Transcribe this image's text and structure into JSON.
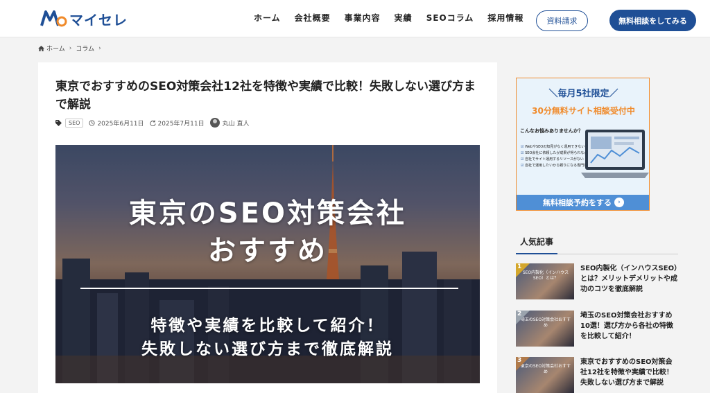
{
  "brand": {
    "name": "マイセレ",
    "color": "#1f4f96",
    "accent": "#f08a2a"
  },
  "nav": [
    "ホーム",
    "会社概要",
    "事業内容",
    "実績",
    "SEOコラム",
    "採用情報"
  ],
  "header_buttons": {
    "doc": "資料請求",
    "free": "無料相談をしてみる"
  },
  "breadcrumb": [
    "ホーム",
    "コラム"
  ],
  "post": {
    "title": "東京でおすすめのSEO対策会社12社を特徴や実績で比較！失敗しない選び方まで解説",
    "category": "SEO",
    "published": "2025年6月11日",
    "updated": "2025年7月11日",
    "author": "丸山 直人"
  },
  "hero": {
    "title_line1": "東京のSEO対策会社",
    "title_line2": "おすすめ",
    "sub_line1": "特徴や実績を比較して紹介！",
    "sub_line2": "失敗しない選び方まで徹底解説"
  },
  "ad": {
    "top": "＼毎月5社限定／",
    "sub": "30分無料サイト相談受付中",
    "question": "こんなお悩みありませんか？",
    "items": [
      "WebやSEOの知見がなく運用できない",
      "SEO会社に依頼したが成果が得られなかった",
      "自社でサイト運用するリソースがない",
      "自社で運用したいから頼りになる専門家が欲しい"
    ],
    "cta": "無料相談予約をする",
    "cta_arrow": "›"
  },
  "popular": {
    "heading": "人気記事",
    "items": [
      {
        "rank": "1",
        "thumb": "SEO内製化（インハウスSEO）とは？",
        "title": "SEO内製化（インハウスSEO）とは？メリットデメリットや成功のコツを徹底解説"
      },
      {
        "rank": "2",
        "thumb": "埼玉のSEO対策会社おすすめ",
        "title": "埼玉のSEO対策会社おすすめ10選！選び方から各社の特徴を比較して紹介！"
      },
      {
        "rank": "3",
        "thumb": "東京のSEO対策会社おすすめ",
        "title": "東京でおすすめのSEO対策会社12社を特徴や実績で比較！失敗しない選び方まで解説"
      }
    ]
  }
}
